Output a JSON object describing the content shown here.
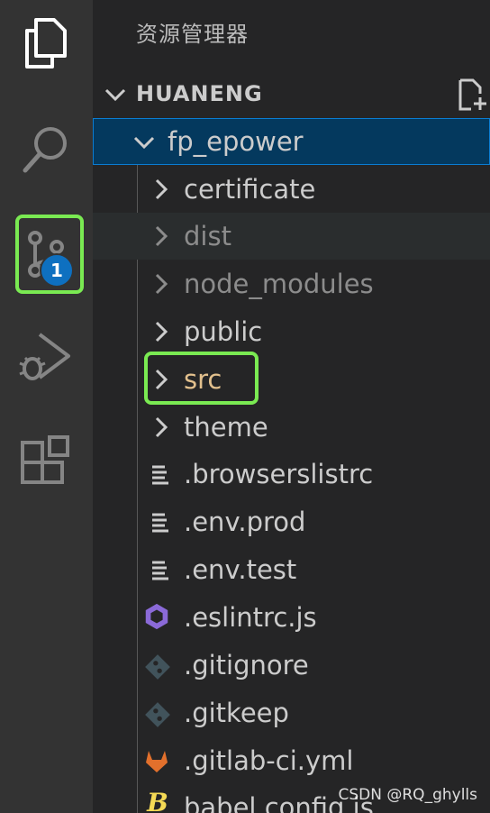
{
  "activity_bar": {
    "items": [
      {
        "name": "explorer",
        "icon": "files-icon"
      },
      {
        "name": "search",
        "icon": "search-icon"
      },
      {
        "name": "source-control",
        "icon": "source-control-icon",
        "badge": "1"
      },
      {
        "name": "run-debug",
        "icon": "run-debug-icon"
      },
      {
        "name": "extensions",
        "icon": "extensions-icon"
      }
    ]
  },
  "sidebar": {
    "title": "资源管理器",
    "section_title": "HUANENG",
    "root_folder": "fp_epower",
    "items": [
      {
        "label": "certificate",
        "kind": "folder"
      },
      {
        "label": "dist",
        "kind": "folder",
        "dimmed": true
      },
      {
        "label": "node_modules",
        "kind": "folder",
        "dimmed": true
      },
      {
        "label": "public",
        "kind": "folder"
      },
      {
        "label": "src",
        "kind": "folder",
        "modified": true
      },
      {
        "label": "theme",
        "kind": "folder"
      },
      {
        "label": ".browserslistrc",
        "kind": "file",
        "icon": "lines-icon"
      },
      {
        "label": ".env.prod",
        "kind": "file",
        "icon": "lines-icon"
      },
      {
        "label": ".env.test",
        "kind": "file",
        "icon": "lines-icon"
      },
      {
        "label": ".eslintrc.js",
        "kind": "file",
        "icon": "eslint-icon"
      },
      {
        "label": ".gitignore",
        "kind": "file",
        "icon": "git-icon"
      },
      {
        "label": ".gitkeep",
        "kind": "file",
        "icon": "git-icon"
      },
      {
        "label": ".gitlab-ci.yml",
        "kind": "file",
        "icon": "gitlab-icon"
      },
      {
        "label": "babel.config.js",
        "kind": "file",
        "icon": "babel-icon"
      }
    ]
  },
  "colors": {
    "highlight": "#7aea52",
    "selection": "#04395e",
    "badge": "#0e70c0",
    "modified": "#e2c08d"
  },
  "watermark": "CSDN @RQ_ghylls"
}
